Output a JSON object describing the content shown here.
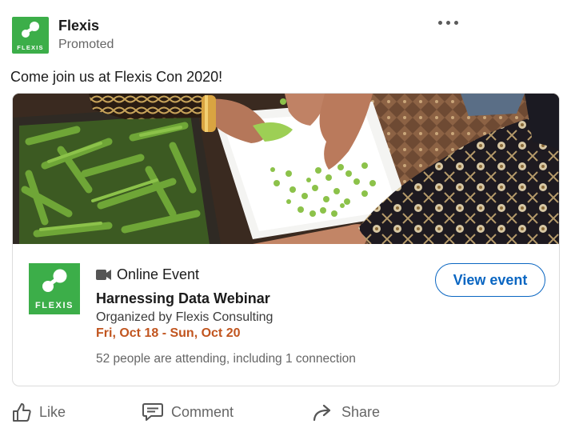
{
  "post": {
    "company_name": "Flexis",
    "company_logo_text": "FLEXIS",
    "promoted_label": "Promoted",
    "body_text": "Come join us at Flexis Con 2020!",
    "more_menu_icon": "more-horizontal-icon"
  },
  "event": {
    "logo_text": "FLEXIS",
    "type_icon": "video-camera-icon",
    "type_label": "Online Event",
    "title": "Harnessing Data Webinar",
    "organizer": "Organized by Flexis Consulting",
    "dates": "Fri, Oct 18 - Sun, Oct 20",
    "attendance": "52 people are attending, including 1 connection",
    "cta_label": "View event",
    "image_description_icon": "photo"
  },
  "actions": [
    {
      "label": "Like",
      "icon": "thumbs-up-icon"
    },
    {
      "label": "Comment",
      "icon": "comment-icon"
    },
    {
      "label": "Share",
      "icon": "share-arrow-icon"
    }
  ],
  "colors": {
    "brand_green": "#3cae49",
    "link_blue": "#0a66c2",
    "date_orange": "#c1551f",
    "muted_text": "#666666"
  }
}
